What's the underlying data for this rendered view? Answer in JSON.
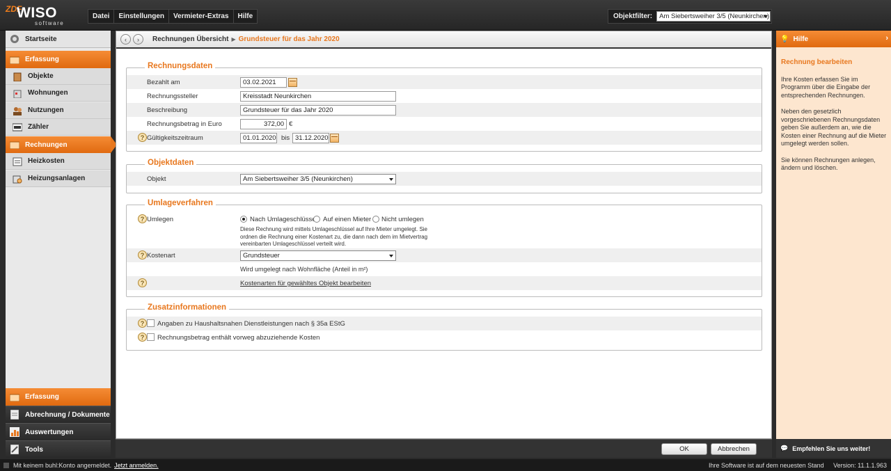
{
  "app": {
    "logo_zdf": "ZDF",
    "logo_name": "WISO",
    "logo_sub": "software"
  },
  "menu": [
    "Datei",
    "Einstellungen",
    "Vermieter-Extras",
    "Hilfe"
  ],
  "objektfilter": {
    "label": "Objektfilter:",
    "value": "Am Siebertsweiher 3/5 (Neunkirchen)"
  },
  "sidebar": {
    "home": "Startseite",
    "section_top": "Erfassung",
    "items": [
      "Objekte",
      "Wohnungen",
      "Nutzungen",
      "Zähler",
      "Rechnungen",
      "Heizkosten",
      "Heizungsanlagen"
    ],
    "active": "Rechnungen",
    "bottom": [
      "Erfassung",
      "Abrechnung / Dokumente",
      "Auswertungen",
      "Tools"
    ]
  },
  "breadcrumb": {
    "parent": "Rechnungen Übersicht",
    "current": "Grundsteuer für das Jahr 2020"
  },
  "rechnungsdaten": {
    "title": "Rechnungsdaten",
    "bezahlt_label": "Bezahlt am",
    "bezahlt_value": "03.02.2021",
    "steller_label": "Rechnungssteller",
    "steller_value": "Kreisstadt Neunkirchen",
    "beschreibung_label": "Beschreibung",
    "beschreibung_value": "Grundsteuer für das Jahr 2020",
    "betrag_label": "Rechnungsbetrag in Euro",
    "betrag_value": "372,00",
    "betrag_unit": "€",
    "zeitraum_label": "Gültigkeitszeitraum",
    "zeitraum_from": "01.01.2020",
    "zeitraum_bis": "bis",
    "zeitraum_to": "31.12.2020"
  },
  "objektdaten": {
    "title": "Objektdaten",
    "objekt_label": "Objekt",
    "objekt_value": "Am Siebertsweiher 3/5 (Neunkirchen)"
  },
  "umlage": {
    "title": "Umlageverfahren",
    "umlegen_label": "Umlegen",
    "options": [
      "Nach Umlageschlüssel",
      "Auf einen Mieter",
      "Nicht umlegen"
    ],
    "selected": "Nach Umlageschlüssel",
    "info_lines": [
      "Diese Rechnung wird mittels Umlageschlüssel auf Ihre Mieter umgelegt. Sie",
      "ordnen die Rechnung einer Kostenart zu, die dann nach dem im Mietvertrag",
      "vereinbarten Umlageschlüssel verteilt wird."
    ],
    "kostenart_label": "Kostenart",
    "kostenart_value": "Grundsteuer",
    "verteilung": "Wird umgelegt nach Wohnfläche (Anteil in m²)",
    "link": "Kostenarten für gewähltes Objekt bearbeiten"
  },
  "zusatz": {
    "title": "Zusatzinformationen",
    "check1": "Angaben zu Haushaltsnahen Dienstleistungen nach § 35a EStG",
    "check2": "Rechnungsbetrag enthält vorweg abzuziehende Kosten"
  },
  "buttons": {
    "ok": "OK",
    "cancel": "Abbrechen"
  },
  "help": {
    "header": "Hilfe",
    "title": "Rechnung bearbeiten",
    "p1": "Ihre Kosten erfassen Sie im Programm über die Eingabe der entsprechenden Rechnungen.",
    "p2": "Neben den gesetzlich vorgeschriebenen Rechnungsdaten geben Sie außerdem an, wie die Kosten einer Rechnung auf die Mieter umgelegt werden sollen.",
    "p3": "Sie können Rechnungen anlegen, ändern und löschen.",
    "footer": "Empfehlen Sie uns weiter!"
  },
  "status": {
    "login_text": "Mit keinem buhl:Konto angemeldet.",
    "login_link": "Jetzt anmelden.",
    "update": "Ihre Software ist auf dem neuesten Stand",
    "version": "Version: 11.1.1.963"
  },
  "colors": {
    "accent": "#e8781f",
    "dark": "#2b2b2b",
    "help_bg": "#fde6cf"
  }
}
